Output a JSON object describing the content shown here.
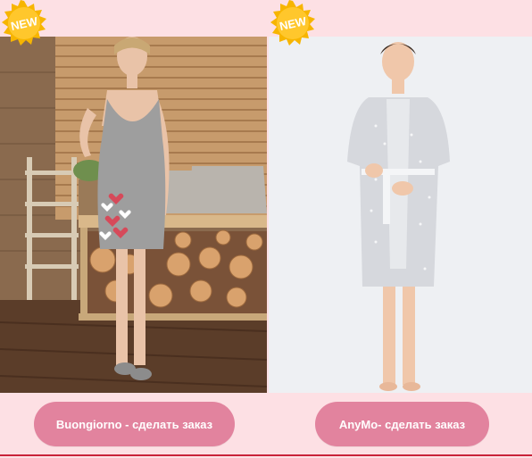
{
  "products": [
    {
      "badge": "NEW",
      "button_label": "Buongiorno - сделать заказ"
    },
    {
      "badge": "NEW",
      "button_label": "AnyMo- сделать заказ"
    }
  ],
  "colors": {
    "background": "#fde0e4",
    "button": "#e2839e",
    "button_text": "#ffffff",
    "badge": "#f7b500",
    "bottom_line": "#c9233a"
  },
  "icons": [
    "new-badge-icon"
  ]
}
